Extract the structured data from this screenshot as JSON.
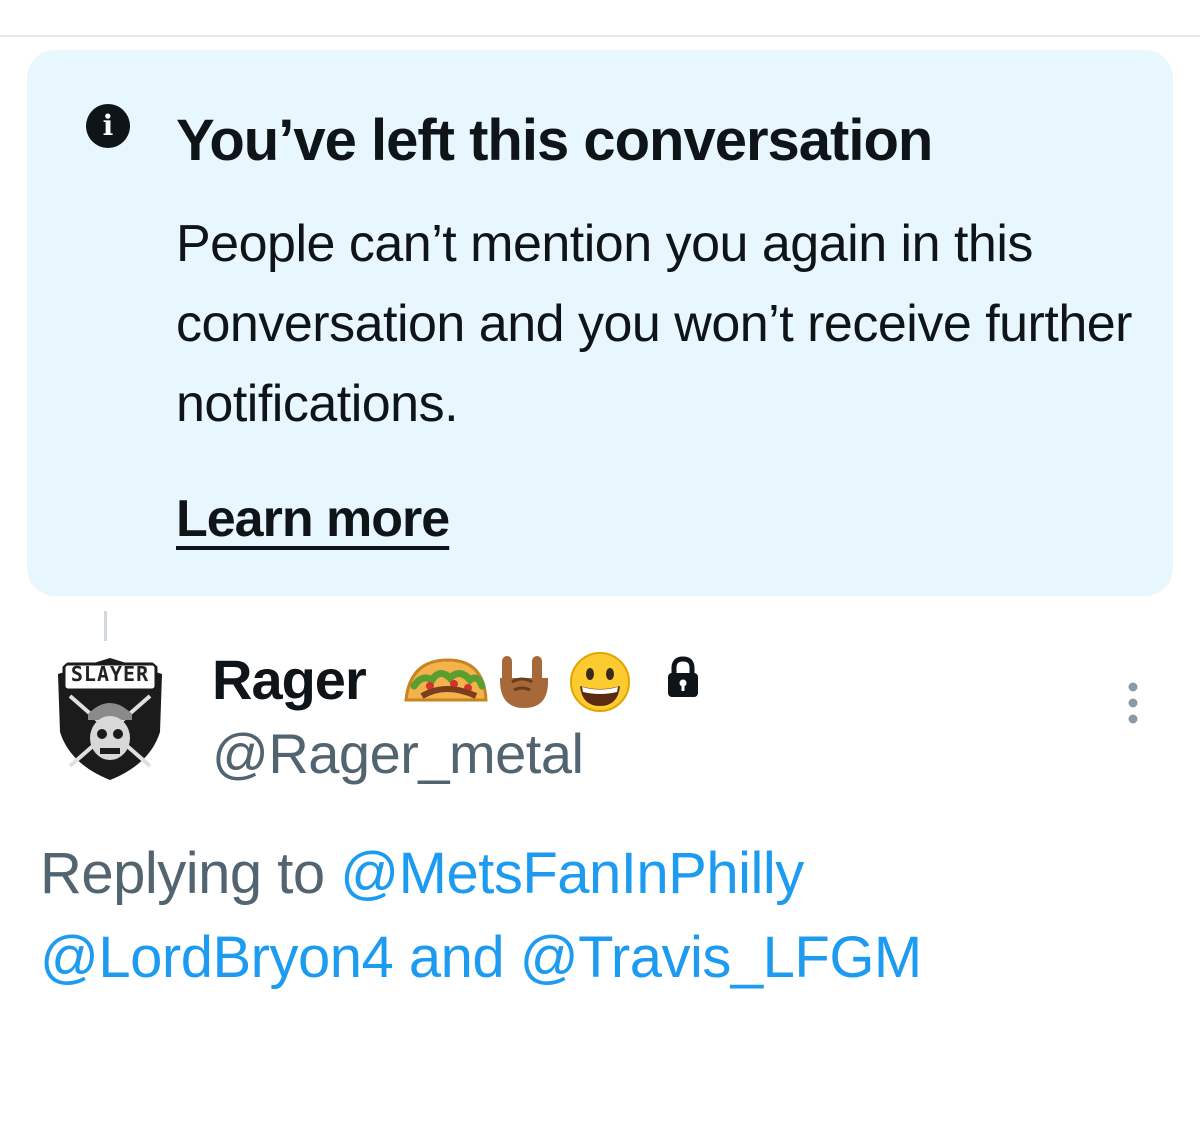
{
  "notice": {
    "title": "You’ve left this conversation",
    "body": "People can’t mention you again in this conversation and you won’t receive further notifications.",
    "learn_more": "Learn more",
    "icon": "info-icon"
  },
  "tweet": {
    "display_name": "Rager",
    "name_emojis": [
      "taco-emoji",
      "rock-on-hand-emoji",
      "grinning-face-emoji"
    ],
    "protected_icon": "lock-icon",
    "handle": "@Rager_metal",
    "avatar_label": "SLAYER",
    "menu_icon": "more-vertical-icon",
    "replying_prefix": "Replying to",
    "mentions": [
      "@MetsFanInPhilly",
      "@LordBryon4",
      "@Travis_LFGM"
    ],
    "conjunction": "and"
  },
  "colors": {
    "notice_bg": "#e8f6fd",
    "link": "#1d9bf0",
    "secondary_text": "#536471",
    "primary_text": "#0f1419"
  }
}
